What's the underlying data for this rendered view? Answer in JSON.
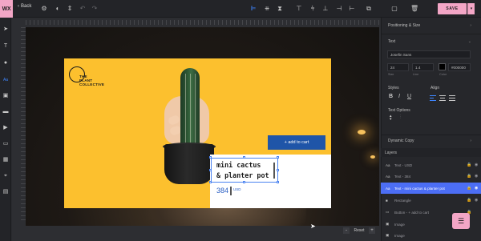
{
  "app": {
    "logo": "WX",
    "back_label": "Back"
  },
  "toolbar": {
    "save_label": "SAVE",
    "icons": [
      "gear-icon",
      "fill-icon",
      "move-vertical-icon",
      "undo-icon",
      "redo-icon",
      "align-left-icon",
      "align-center-icon",
      "distribute-icon",
      "align-top-icon",
      "align-middle-icon",
      "align-bottom-icon",
      "align-hcenter-icon",
      "align-right-edge-icon",
      "copy-icon",
      "group-icon",
      "delete-icon"
    ],
    "accent": "#f3a6c6",
    "active_icon_color": "#3f86ff"
  },
  "left_tools": [
    "cursor-icon",
    "text-icon",
    "rectangle-icon",
    "ellipse-icon",
    "heading-icon",
    "image-icon",
    "video-icon",
    "button-icon",
    "gallery-icon",
    "map-icon"
  ],
  "canvas": {
    "brand": {
      "line1": "THE",
      "line2": "PLANT",
      "line3": "COLLECTIVE"
    },
    "add_to_cart": "+ add to cart",
    "product_name_line1": "mini cactus",
    "product_name_line2": "& planter pot",
    "price": "384",
    "currency": "USD",
    "banner_color": "#fcc02e",
    "button_color": "#1f55a8",
    "price_color": "#2a5fc4"
  },
  "zoom": {
    "minus": "-",
    "reset": "Reset",
    "plus": "+"
  },
  "right_panel": {
    "positioning_title": "Positioning & Size",
    "text_title": "Text",
    "font_value": "Josefin Sans",
    "size_value": "24",
    "size_label": "Size",
    "line_value": "1.4",
    "line_label": "Line",
    "color_value": "#000000",
    "color_label": "Color",
    "styles_label": "Styles",
    "align_label": "Align",
    "style_bold": "B",
    "style_italic": "I",
    "style_underline": "U",
    "text_options_label": "Text Options",
    "dynamic_copy_label": "Dynamic Copy",
    "layers_title": "Layers",
    "layers": [
      {
        "icon": "Aa",
        "name": "Text - USD",
        "active": false
      },
      {
        "icon": "Aa",
        "name": "Text - 384",
        "active": false
      },
      {
        "icon": "Aa",
        "name": "Text - mini cactus & planter pot",
        "active": true
      },
      {
        "icon": "■",
        "name": "Rectangle",
        "active": false
      },
      {
        "icon": "▭",
        "name": "Button - + add to cart",
        "active": false
      },
      {
        "icon": "▣",
        "name": "Image",
        "active": false
      },
      {
        "icon": "▣",
        "name": "Image",
        "active": false
      }
    ],
    "active_layer_color": "#4c6ef5"
  }
}
